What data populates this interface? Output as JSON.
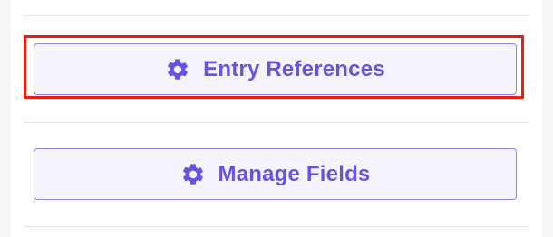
{
  "colors": {
    "accent": "#6454e1",
    "button_border": "#8f83e3",
    "button_background": "#f5f3fb",
    "highlight": "#ee1c0c",
    "divider": "#e3e3ea"
  },
  "buttons": [
    {
      "label": "Entry References",
      "icon": "gear-icon"
    },
    {
      "label": "Manage Fields",
      "icon": "gear-icon"
    }
  ]
}
